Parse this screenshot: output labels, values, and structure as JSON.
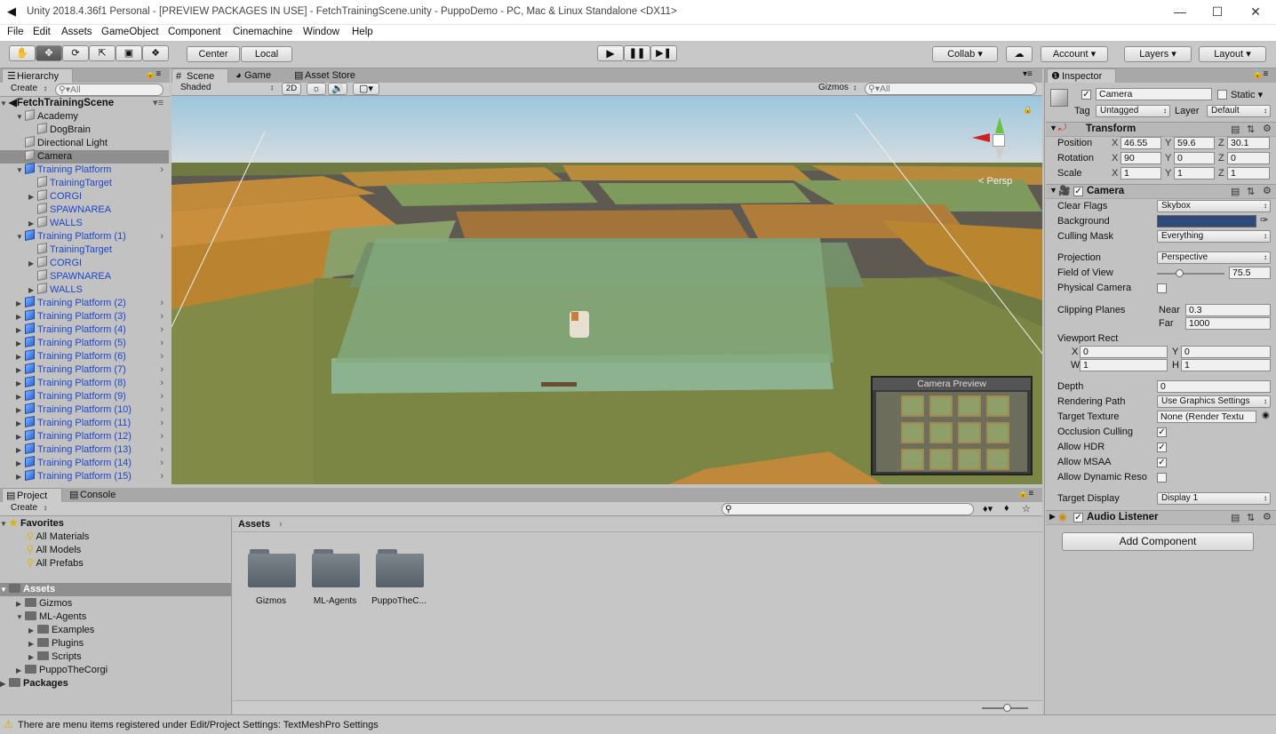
{
  "window": {
    "title": "Unity 2018.4.36f1 Personal - [PREVIEW PACKAGES IN USE] - FetchTrainingScene.unity - PuppoDemo - PC, Mac & Linux Standalone <DX11>"
  },
  "menu": [
    "File",
    "Edit",
    "Assets",
    "GameObject",
    "Component",
    "Cinemachine",
    "Window",
    "Help"
  ],
  "toolbar": {
    "pivot": "Center",
    "space": "Local",
    "collab": "Collab",
    "account": "Account",
    "layers": "Layers",
    "layout": "Layout"
  },
  "hierarchy": {
    "tab": "Hierarchy",
    "create": "Create",
    "search_placeholder": "All",
    "scene": "FetchTrainingScene",
    "items": [
      {
        "label": "Academy",
        "indent": 1,
        "arrow": "open",
        "icon": "gray",
        "blue": false
      },
      {
        "label": "DogBrain",
        "indent": 2,
        "arrow": "",
        "icon": "gray",
        "blue": false
      },
      {
        "label": "Directional Light",
        "indent": 1,
        "arrow": "",
        "icon": "gray",
        "blue": false
      },
      {
        "label": "Camera",
        "indent": 1,
        "arrow": "",
        "icon": "gray",
        "blue": false,
        "selected": true
      },
      {
        "label": "Training Platform",
        "indent": 1,
        "arrow": "open",
        "icon": "blue",
        "blue": true,
        "chev": true
      },
      {
        "label": "TrainingTarget",
        "indent": 2,
        "arrow": "",
        "icon": "gray",
        "blue": true
      },
      {
        "label": "CORGI",
        "indent": 2,
        "arrow": "closed",
        "icon": "gray",
        "blue": true
      },
      {
        "label": "SPAWNAREA",
        "indent": 2,
        "arrow": "",
        "icon": "gray",
        "blue": true
      },
      {
        "label": "WALLS",
        "indent": 2,
        "arrow": "closed",
        "icon": "gray",
        "blue": true
      },
      {
        "label": "Training Platform (1)",
        "indent": 1,
        "arrow": "open",
        "icon": "blue",
        "blue": true,
        "chev": true
      },
      {
        "label": "TrainingTarget",
        "indent": 2,
        "arrow": "",
        "icon": "gray",
        "blue": true
      },
      {
        "label": "CORGI",
        "indent": 2,
        "arrow": "closed",
        "icon": "gray",
        "blue": true
      },
      {
        "label": "SPAWNAREA",
        "indent": 2,
        "arrow": "",
        "icon": "gray",
        "blue": true
      },
      {
        "label": "WALLS",
        "indent": 2,
        "arrow": "closed",
        "icon": "gray",
        "blue": true
      },
      {
        "label": "Training Platform (2)",
        "indent": 1,
        "arrow": "closed",
        "icon": "blue",
        "blue": true,
        "chev": true
      },
      {
        "label": "Training Platform (3)",
        "indent": 1,
        "arrow": "closed",
        "icon": "blue",
        "blue": true,
        "chev": true
      },
      {
        "label": "Training Platform (4)",
        "indent": 1,
        "arrow": "closed",
        "icon": "blue",
        "blue": true,
        "chev": true
      },
      {
        "label": "Training Platform (5)",
        "indent": 1,
        "arrow": "closed",
        "icon": "blue",
        "blue": true,
        "chev": true
      },
      {
        "label": "Training Platform (6)",
        "indent": 1,
        "arrow": "closed",
        "icon": "blue",
        "blue": true,
        "chev": true
      },
      {
        "label": "Training Platform (7)",
        "indent": 1,
        "arrow": "closed",
        "icon": "blue",
        "blue": true,
        "chev": true
      },
      {
        "label": "Training Platform (8)",
        "indent": 1,
        "arrow": "closed",
        "icon": "blue",
        "blue": true,
        "chev": true
      },
      {
        "label": "Training Platform (9)",
        "indent": 1,
        "arrow": "closed",
        "icon": "blue",
        "blue": true,
        "chev": true
      },
      {
        "label": "Training Platform (10)",
        "indent": 1,
        "arrow": "closed",
        "icon": "blue",
        "blue": true,
        "chev": true
      },
      {
        "label": "Training Platform (11)",
        "indent": 1,
        "arrow": "closed",
        "icon": "blue",
        "blue": true,
        "chev": true
      },
      {
        "label": "Training Platform (12)",
        "indent": 1,
        "arrow": "closed",
        "icon": "blue",
        "blue": true,
        "chev": true
      },
      {
        "label": "Training Platform (13)",
        "indent": 1,
        "arrow": "closed",
        "icon": "blue",
        "blue": true,
        "chev": true
      },
      {
        "label": "Training Platform (14)",
        "indent": 1,
        "arrow": "closed",
        "icon": "blue",
        "blue": true,
        "chev": true
      },
      {
        "label": "Training Platform (15)",
        "indent": 1,
        "arrow": "closed",
        "icon": "blue",
        "blue": true,
        "chev": true
      }
    ]
  },
  "scene_tabs": {
    "scene": "Scene",
    "game": "Game",
    "store": "Asset Store"
  },
  "scene_toolbar": {
    "shading": "Shaded",
    "mode2d": "2D",
    "gizmos": "Gizmos",
    "search_placeholder": "All",
    "persp": "Persp",
    "camera_preview": "Camera Preview"
  },
  "project": {
    "tab": "Project",
    "console": "Console",
    "create": "Create",
    "breadcrumb": "Assets",
    "favorites": {
      "label": "Favorites",
      "items": [
        "All Materials",
        "All Models",
        "All Prefabs"
      ]
    },
    "assets": {
      "label": "Assets",
      "items": [
        {
          "label": "Gizmos",
          "indent": 1,
          "arrow": "closed"
        },
        {
          "label": "ML-Agents",
          "indent": 1,
          "arrow": "open"
        },
        {
          "label": "Examples",
          "indent": 2,
          "arrow": "closed"
        },
        {
          "label": "Plugins",
          "indent": 2,
          "arrow": "closed"
        },
        {
          "label": "Scripts",
          "indent": 2,
          "arrow": "closed"
        },
        {
          "label": "PuppoTheCorgi",
          "indent": 1,
          "arrow": "closed"
        }
      ]
    },
    "packages": "Packages",
    "folders": [
      "Gizmos",
      "ML-Agents",
      "PuppoTheC..."
    ]
  },
  "inspector": {
    "tab": "Inspector",
    "name": "Camera",
    "static": "Static",
    "tag_label": "Tag",
    "tag": "Untagged",
    "layer_label": "Layer",
    "layer": "Default",
    "transform": {
      "title": "Transform",
      "position_label": "Position",
      "rotation_label": "Rotation",
      "scale_label": "Scale",
      "position": {
        "x": "46.55",
        "y": "59.6",
        "z": "30.1"
      },
      "rotation": {
        "x": "90",
        "y": "0",
        "z": "0"
      },
      "scale": {
        "x": "1",
        "y": "1",
        "z": "1"
      }
    },
    "camera": {
      "title": "Camera",
      "clear_flags_label": "Clear Flags",
      "clear_flags": "Skybox",
      "background_label": "Background",
      "background_color": "#2f4a78",
      "culling_label": "Culling Mask",
      "culling": "Everything",
      "projection_label": "Projection",
      "projection": "Perspective",
      "fov_label": "Field of View",
      "fov": "75.5",
      "fov_fraction": 0.33,
      "physical_label": "Physical Camera",
      "clipping_label": "Clipping Planes",
      "near_label": "Near",
      "near": "0.3",
      "far_label": "Far",
      "far": "1000",
      "viewport_label": "Viewport Rect",
      "vx": "0",
      "vy": "0",
      "vw": "1",
      "vh": "1",
      "depth_label": "Depth",
      "depth": "0",
      "rendering_label": "Rendering Path",
      "rendering": "Use Graphics Settings",
      "target_tex_label": "Target Texture",
      "target_tex": "None (Render Textu",
      "occlusion_label": "Occlusion Culling",
      "hdr_label": "Allow HDR",
      "msaa_label": "Allow MSAA",
      "dynres_label": "Allow Dynamic Reso",
      "display_label": "Target Display",
      "display": "Display 1"
    },
    "audio": {
      "title": "Audio Listener"
    },
    "add_component": "Add Component"
  },
  "status": {
    "message": "There are menu items registered under Edit/Project Settings: TextMeshPro Settings"
  },
  "colors": {
    "accent_blue": "#1f46c8",
    "selection": "#8f8f8f"
  }
}
